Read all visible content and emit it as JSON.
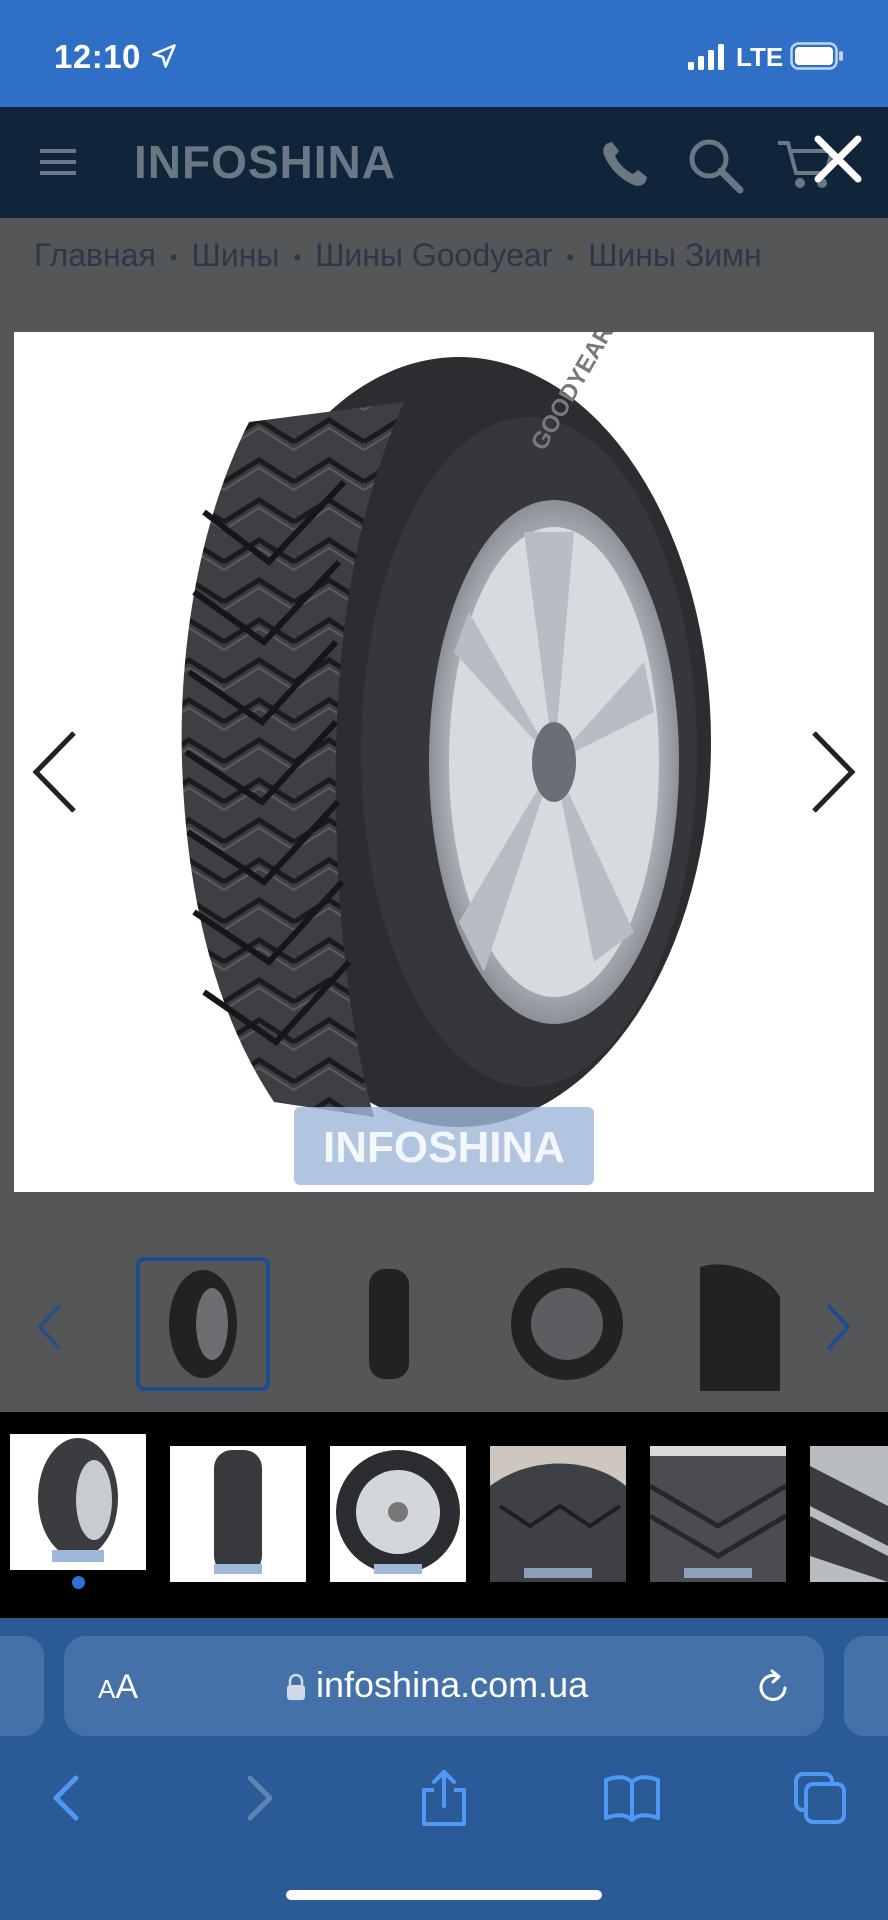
{
  "status_bar": {
    "time": "12:10",
    "network": "LTE"
  },
  "site": {
    "logo": "INFOSHINA",
    "breadcrumb": [
      "Главная",
      "Шины",
      "Шины Goodyear",
      "Шины Зимн"
    ],
    "watermark": "INFOSHINA"
  },
  "gallery": {
    "count": 6,
    "active_index": 0
  },
  "browser": {
    "aa_small": "A",
    "aa_big": "A",
    "url": "infoshina.com.ua"
  },
  "colors": {
    "status_bar": "#2f6fc6",
    "site_header": "#10253a",
    "browser": "#2b5b96",
    "url_bar": "#4371a8",
    "dot": "#2f6fd8"
  }
}
